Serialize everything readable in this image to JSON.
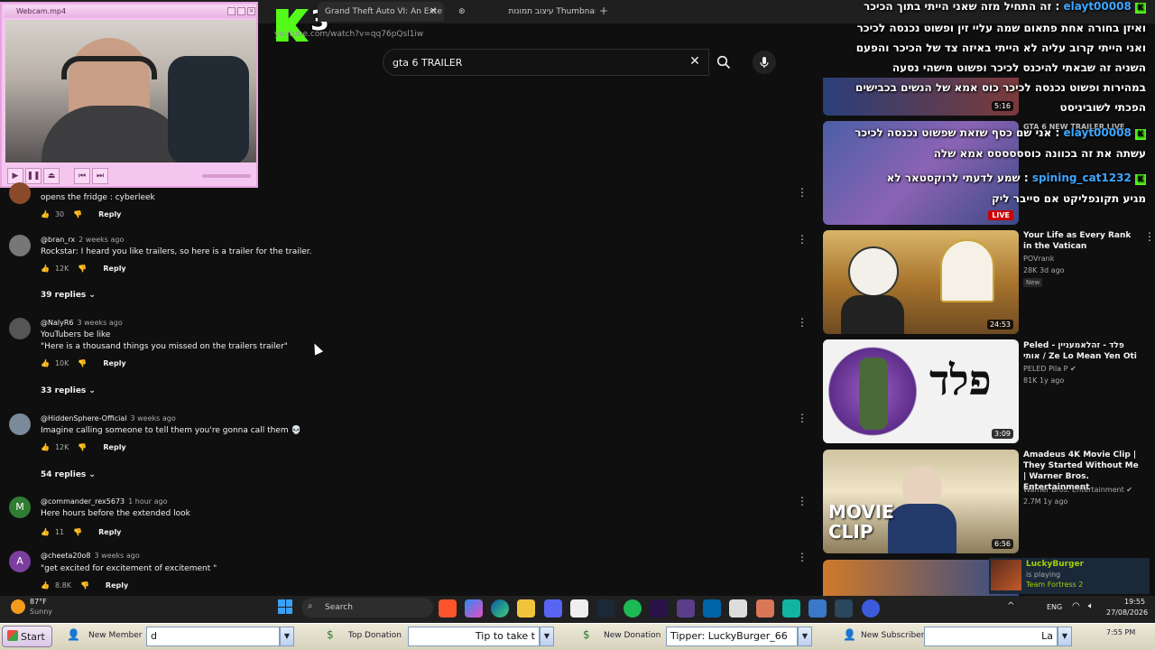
{
  "browser": {
    "tabs": [
      {
        "label": "Grand Theft Auto VI: An Exte",
        "active": true
      },
      {
        "label": "עיצוב תמונות Thumbnail",
        "active": false
      }
    ],
    "url": "youtube.com/watch?v=qq76pQsl1iw"
  },
  "search": {
    "query": "gta 6 TRAILER"
  },
  "webcam": {
    "title": "Webcam.mp4"
  },
  "comments": [
    {
      "author": "",
      "time": "",
      "text": "opens the fridge : cyberleek",
      "likes": "30",
      "reply": "Reply",
      "avatar": "",
      "replies": ""
    },
    {
      "author": "@bran_rx",
      "time": "2 weeks ago",
      "text": "Rockstar: I heard you like trailers, so here is a trailer for the trailer.",
      "likes": "12K",
      "reply": "Reply",
      "avatar": "",
      "replies": "39 replies"
    },
    {
      "author": "@NalyR6",
      "time": "3 weeks ago",
      "text": "YouTubers be like\n\"Here is a thousand things you missed on the trailers trailer\"",
      "likes": "10K",
      "reply": "Reply",
      "avatar": "",
      "replies": "33 replies"
    },
    {
      "author": "@HiddenSphere-Official",
      "time": "3 weeks ago",
      "text": "Imagine calling someone to tell them you're gonna call them 💀",
      "likes": "12K",
      "reply": "Reply",
      "avatar": "",
      "replies": "54 replies"
    },
    {
      "author": "@commander_rex5673",
      "time": "1 hour ago",
      "text": "Here hours before the extended look",
      "likes": "11",
      "reply": "Reply",
      "avatar": "M",
      "replies": ""
    },
    {
      "author": "@cheeta20o8",
      "time": "3 weeks ago",
      "text": "\"get excited for excitement of excitement \"",
      "likes": "8.8K",
      "reply": "Reply",
      "avatar": "A",
      "replies": ""
    }
  ],
  "sidebar": {
    "videos": [
      {
        "duration": "5:16",
        "title": "",
        "channel": "",
        "meta": "",
        "badge": ""
      },
      {
        "duration": "LIVE",
        "title": "GTA 6 NEW TRAILER LIVE",
        "channel": "",
        "meta": "",
        "badge": ""
      },
      {
        "duration": "24:53",
        "title": "Your Life as Every Rank in the Vatican",
        "channel": "POVrank",
        "meta": "28K  3d ago",
        "badge": "New"
      },
      {
        "duration": "3:09",
        "title": "Peled - פלד - זהלאמעניין אותי / Ze Lo Mean Yen Oti",
        "channel": "PELED Pila P",
        "meta": "81K  1y ago",
        "badge": ""
      },
      {
        "duration": "6:56",
        "title": "Amadeus 4K Movie Clip | They Started Without Me | Warner Bros. Entertainment",
        "channel": "Warner Bros. Entertainment",
        "meta": "2.7M  1y ago",
        "badge": ""
      }
    ],
    "thumb_text": {
      "peled": "פלד",
      "movie": "MOVIE CLIP"
    }
  },
  "chat": [
    {
      "user": "elayt00008",
      "message": "זה התחיל מזה שאני הייתי בתוך הכיכר"
    },
    {
      "user": "",
      "message": "ואיזן בחורה אחת פתאום שמה עליי זין ופשוט נכנסה לכיכר"
    },
    {
      "user": "",
      "message": "ואני הייתי קרוב עליה לא הייתי באיזה צד של הכיכר והפעם"
    },
    {
      "user": "",
      "message": "השניה זה שבאתי להיכנס לכיכר ופשוט מישהי נסעה"
    },
    {
      "user": "",
      "message": "במהירות ופשוט נכנסה לכיכר כוס אמא של הנשים בכבישים"
    },
    {
      "user": "",
      "message": "הפכתי לשוביניסט"
    },
    {
      "user": "elayt00008",
      "message": "אני שם כסף שזאת שפשוט נכנסה לכיכר"
    },
    {
      "user": "",
      "message": "עשתה את זה בכוונה כוסססססס אמא שלה"
    },
    {
      "user": "spining_cat1232",
      "message": "שמע לדעתי לרוקסטאר לא"
    },
    {
      "user": "",
      "message": "מגיע תקונפליקט אם סייבר ליק"
    }
  ],
  "notification": {
    "name": "LuckyBurger",
    "line1": "is playing",
    "line2": "Team Fortress 2"
  },
  "taskbar": {
    "weather_temp": "87°F",
    "weather_text": "Sunny",
    "search_label": "Search",
    "lang": "ENG",
    "time": "19:55",
    "date": "27/08/2026"
  },
  "xpbar": {
    "start": "Start",
    "new_member": "New Member",
    "new_member_value": "d",
    "top_donation": "Top Donation",
    "top_donation_value": "Tip to take t",
    "new_donation": "New Donation",
    "new_donation_value": "Tipper: LuckyBurger_66",
    "new_subscriber": "New Subscriber",
    "new_subscriber_value": "La",
    "tray_time": "7:55 PM"
  },
  "colors": {
    "bg": "#0f0f0f",
    "link": "#3ea6ff",
    "kick": "#53fc18",
    "live": "#cc0000"
  }
}
